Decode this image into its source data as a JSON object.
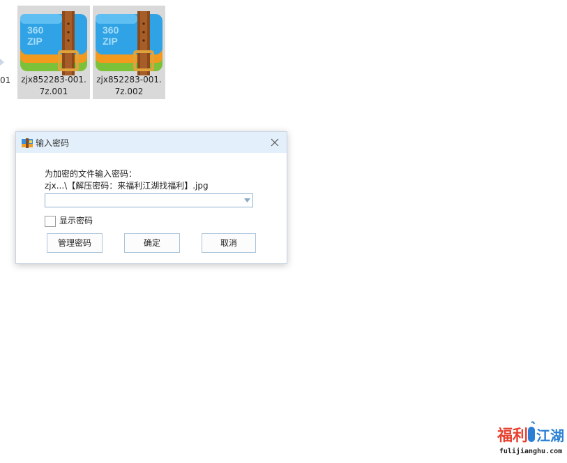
{
  "desktop": {
    "partial_filename_fragment": "01",
    "files": [
      {
        "icon": "360zip-archive-icon",
        "badge_text": "360\nZIP",
        "line1": "zjx852283-001.",
        "line2": "7z.001"
      },
      {
        "icon": "360zip-archive-icon",
        "badge_text": "360\nZIP",
        "line1": "zjx852283-001.",
        "line2": "7z.002"
      }
    ]
  },
  "dialog": {
    "title": "输入密码",
    "prompt": "为加密的文件输入密码：",
    "file_path": "zjx...\\【解压密码：来福利江湖找福利】.jpg",
    "password_value": "",
    "show_password_label": "显示密码",
    "show_password_checked": false,
    "buttons": {
      "manage": "管理密码",
      "ok": "确定",
      "cancel": "取消"
    }
  },
  "watermark": {
    "logo_text": "福利江湖",
    "url": "fulijianghu.com"
  },
  "colors": {
    "titlebar_bg": "#e3effa",
    "tile_selected_bg": "#d9d9d9",
    "button_border": "#a9c4de",
    "zip_blue": "#2fa3e6",
    "zip_orange": "#f39a1e",
    "zip_green": "#7cc13a",
    "strap_brown": "#8a4a1c",
    "watermark_red": "#e8402f"
  }
}
